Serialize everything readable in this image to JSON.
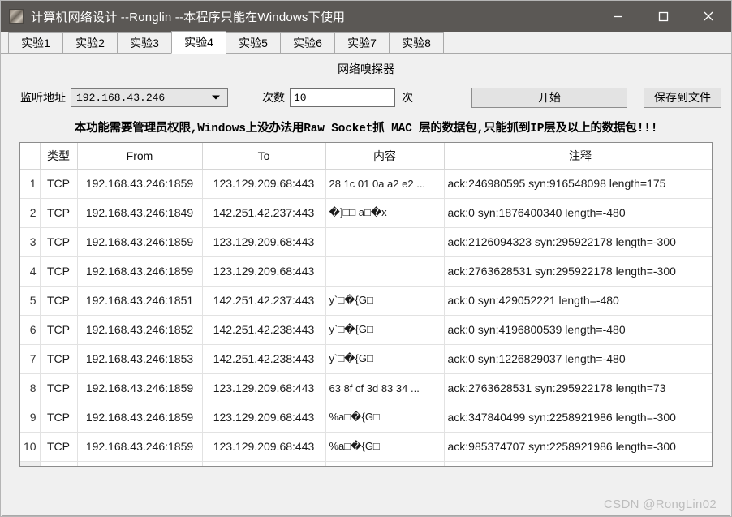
{
  "window": {
    "title": "计算机网络设计 --Ronglin  --本程序只能在Windows下使用",
    "icon": "app-icon",
    "minimize_label": "—",
    "maximize_label": "□",
    "close_label": "✕"
  },
  "tabs": [
    {
      "label": "实验1",
      "selected": false
    },
    {
      "label": "实验2",
      "selected": false
    },
    {
      "label": "实验3",
      "selected": false
    },
    {
      "label": "实验4",
      "selected": true
    },
    {
      "label": "实验5",
      "selected": false
    },
    {
      "label": "实验6",
      "selected": false
    },
    {
      "label": "实验7",
      "selected": false
    },
    {
      "label": "实验8",
      "selected": false
    }
  ],
  "panel": {
    "title": "网络嗅探器",
    "warning": "本功能需要管理员权限,Windows上没办法用Raw Socket抓 MAC 层的数据包,只能抓到IP层及以上的数据包!!!"
  },
  "controls": {
    "listen_label": "监听地址",
    "listen_value": "192.168.43.246",
    "listen_options": [
      "192.168.43.246"
    ],
    "count_label": "次数",
    "count_value": "10",
    "count_unit": "次",
    "start_button": "开始",
    "save_button": "保存到文件"
  },
  "grid": {
    "headers": [
      "",
      "类型",
      "From",
      "To",
      "内容",
      "注释"
    ],
    "rows": [
      {
        "n": "1",
        "type": "TCP",
        "from": "192.168.43.246:1859",
        "to": "123.129.209.68:443",
        "content": "28 1c 01 0a a2 e2 ...",
        "note": "ack:246980595  syn:916548098 length=175"
      },
      {
        "n": "2",
        "type": "TCP",
        "from": "192.168.43.246:1849",
        "to": "142.251.42.237:443",
        "content": "�]□□ a□�x",
        "note": "ack:0  syn:1876400340 length=-480"
      },
      {
        "n": "3",
        "type": "TCP",
        "from": "192.168.43.246:1859",
        "to": "123.129.209.68:443",
        "content": "",
        "note": "ack:2126094323  syn:295922178 length=-300"
      },
      {
        "n": "4",
        "type": "TCP",
        "from": "192.168.43.246:1859",
        "to": "123.129.209.68:443",
        "content": "",
        "note": "ack:2763628531  syn:295922178 length=-300"
      },
      {
        "n": "5",
        "type": "TCP",
        "from": "192.168.43.246:1851",
        "to": "142.251.42.237:443",
        "content": "y`□�{G□",
        "note": "ack:0  syn:429052221 length=-480"
      },
      {
        "n": "6",
        "type": "TCP",
        "from": "192.168.43.246:1852",
        "to": "142.251.42.238:443",
        "content": "y`□�{G□",
        "note": "ack:0  syn:4196800539 length=-480"
      },
      {
        "n": "7",
        "type": "TCP",
        "from": "192.168.43.246:1853",
        "to": "142.251.42.238:443",
        "content": "y`□�{G□",
        "note": "ack:0  syn:1226829037 length=-480"
      },
      {
        "n": "8",
        "type": "TCP",
        "from": "192.168.43.246:1859",
        "to": "123.129.209.68:443",
        "content": "63 8f cf 3d 83 34 ...",
        "note": "ack:2763628531  syn:295922178 length=73"
      },
      {
        "n": "9",
        "type": "TCP",
        "from": "192.168.43.246:1859",
        "to": "123.129.209.68:443",
        "content": "%a□�{G□",
        "note": "ack:347840499  syn:2258921986 length=-300"
      },
      {
        "n": "10",
        "type": "TCP",
        "from": "192.168.43.246:1859",
        "to": "123.129.209.68:443",
        "content": "%a□�{G□",
        "note": "ack:985374707  syn:2258921986 length=-300"
      }
    ]
  },
  "watermark": "CSDN @RongLin02"
}
